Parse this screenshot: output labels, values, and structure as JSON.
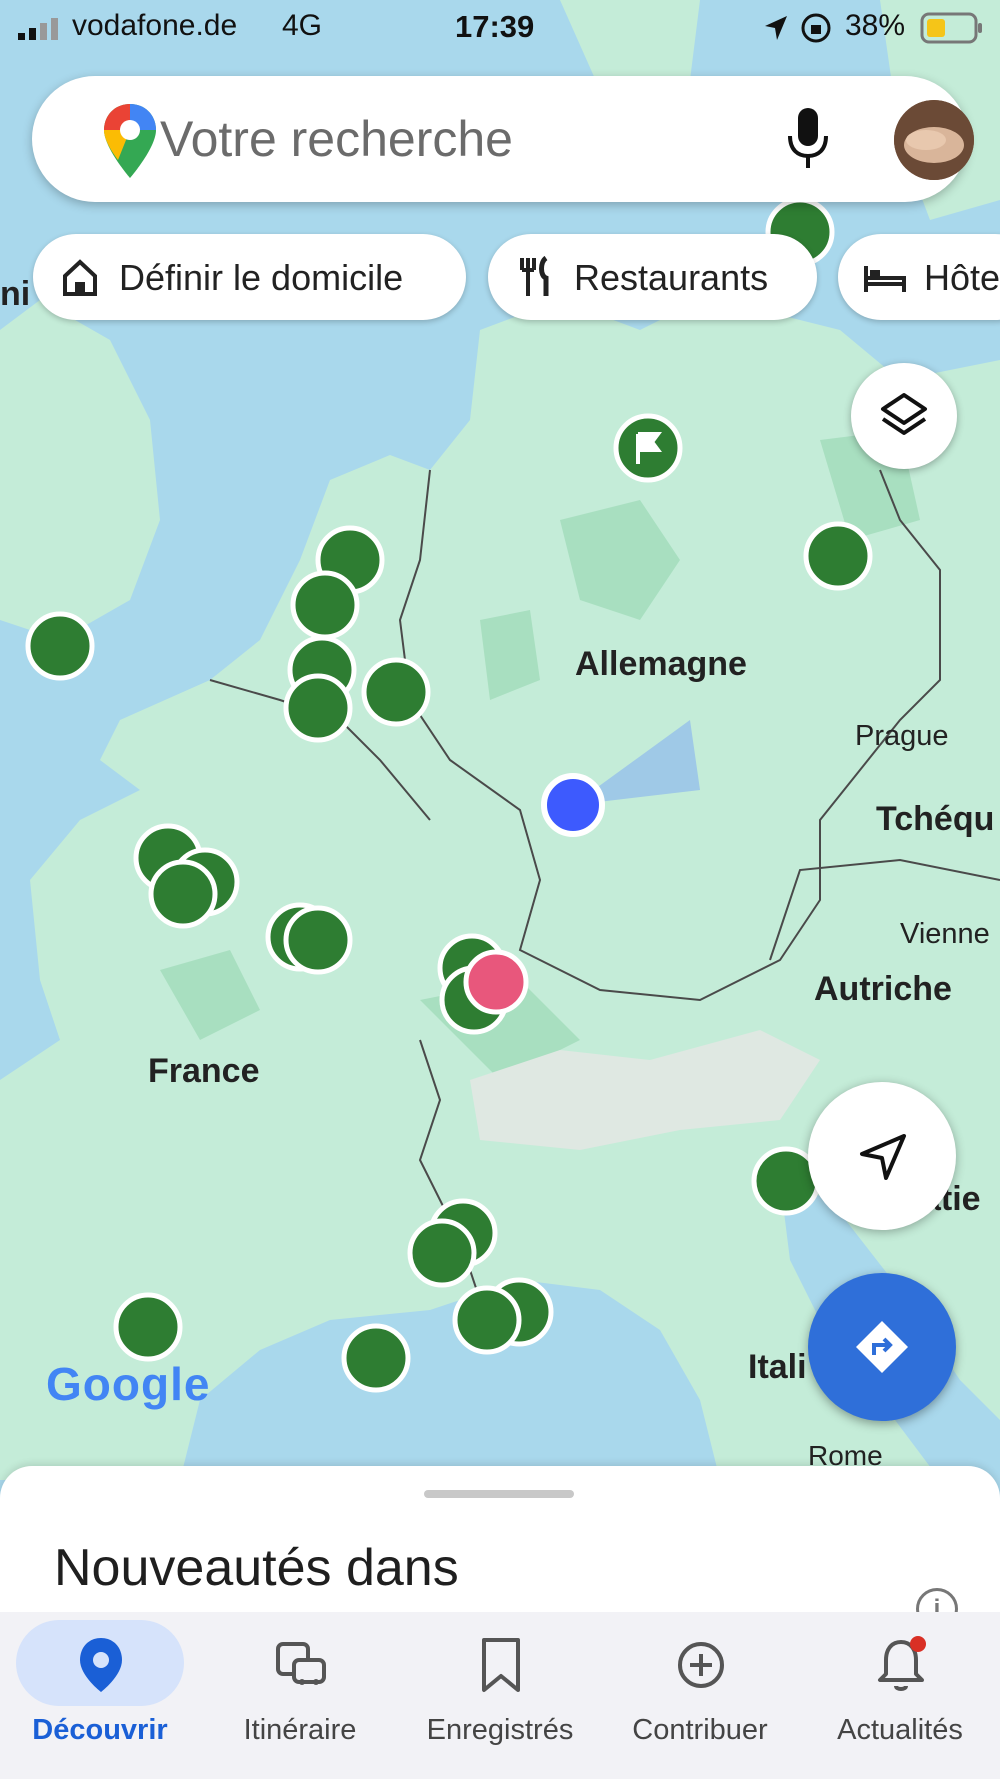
{
  "status_bar": {
    "carrier": "vodafone.de",
    "network": "4G",
    "time": "17:39",
    "battery": "38%"
  },
  "search": {
    "placeholder": "Votre recherche",
    "icons": [
      "google-maps-logo",
      "microphone-icon",
      "profile-avatar"
    ]
  },
  "chips": [
    {
      "label": "Définir le domicile",
      "icon": "home-icon"
    },
    {
      "label": "Restaurants",
      "icon": "fork-knife-icon"
    },
    {
      "label": "Hôte",
      "icon": "bed-icon"
    }
  ],
  "map": {
    "labels": {
      "germany": "Allemagne",
      "france": "France",
      "prague": "Prague",
      "czech": "Tchéqu",
      "vienna": "Vienne",
      "austria": "Autriche",
      "italy": "Itali",
      "rome": "Rome",
      "italy_edge": "atie",
      "left_edge": "ni"
    },
    "google_logo": "Google",
    "colors": {
      "water": "#a9d8ec",
      "land": "#c4ecd8",
      "pin_green": "#2e7d32",
      "pin_pink": "#e8577c",
      "location_blue": "#3d5afe"
    }
  },
  "sheet": {
    "title": "Nouveautés dans",
    "info_icon": "i"
  },
  "bottom_nav": [
    {
      "label": "Découvrir",
      "icon": "location-pin-icon",
      "active": true
    },
    {
      "label": "Itinéraire",
      "icon": "commute-icon",
      "active": false
    },
    {
      "label": "Enregistrés",
      "icon": "bookmark-icon",
      "active": false
    },
    {
      "label": "Contribuer",
      "icon": "add-circle-icon",
      "active": false
    },
    {
      "label": "Actualités",
      "icon": "bell-icon",
      "active": false,
      "badge": true
    }
  ]
}
